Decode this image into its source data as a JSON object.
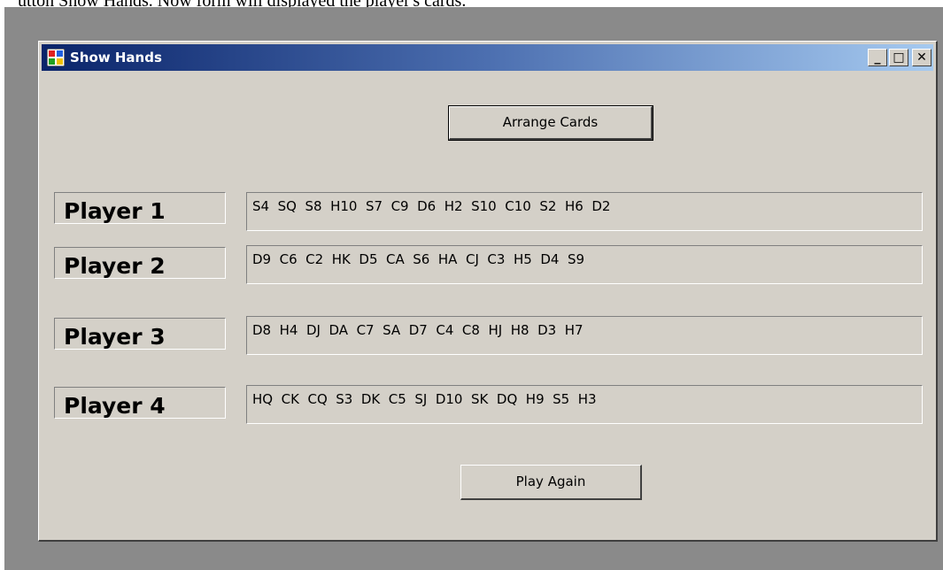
{
  "document": {
    "text_before": "utton ",
    "underlined": "Show Hands",
    "text_after": ". Now form will displayed the player's cards."
  },
  "window": {
    "title": "Show Hands",
    "controls": {
      "minimize": "_",
      "maximize": "□",
      "close": "✕"
    }
  },
  "buttons": {
    "arrange": "Arrange Cards",
    "play_again": "Play Again"
  },
  "players": [
    {
      "label": "Player 1",
      "hand": "S4  SQ  S8  H10  S7  C9  D6  H2  S10  C10  S2  H6  D2"
    },
    {
      "label": "Player 2",
      "hand": "D9  C6  C2  HK  D5  CA  S6  HA  CJ  C3  H5  D4  S9"
    },
    {
      "label": "Player 3",
      "hand": "D8  H4  DJ  DA  C7  SA  D7  C4  C8  HJ  H8  D3  H7"
    },
    {
      "label": "Player 4",
      "hand": "HQ  CK  CQ  S3  DK  C5  SJ  D10  SK  DQ  H9  S5  H3"
    }
  ],
  "icons": {
    "app": "windows-form-icon"
  }
}
